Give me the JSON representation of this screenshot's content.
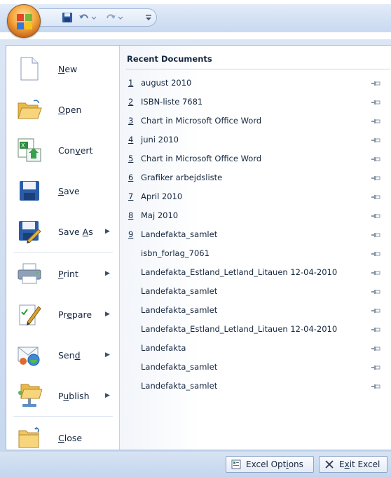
{
  "quick_access": {
    "save_icon": "save-icon",
    "undo_icon": "undo-icon",
    "redo_icon": "redo-icon",
    "customize_icon": "customize-icon"
  },
  "commands": [
    {
      "label": "New",
      "access_key_index": 0,
      "icon": "new-document-icon",
      "has_submenu": false
    },
    {
      "label": "Open",
      "access_key_index": 0,
      "icon": "open-folder-icon",
      "has_submenu": false
    },
    {
      "label": "Convert",
      "access_key_index": 3,
      "icon": "convert-icon",
      "has_submenu": false
    },
    {
      "label": "Save",
      "access_key_index": 0,
      "icon": "save-icon",
      "has_submenu": false
    },
    {
      "label": "Save As",
      "access_key_index": 5,
      "icon": "save-as-icon",
      "has_submenu": true
    },
    {
      "label": "Print",
      "access_key_index": 0,
      "icon": "printer-icon",
      "has_submenu": true
    },
    {
      "label": "Prepare",
      "access_key_index": 2,
      "icon": "prepare-icon",
      "has_submenu": true
    },
    {
      "label": "Send",
      "access_key_index": 3,
      "icon": "send-icon",
      "has_submenu": true
    },
    {
      "label": "Publish",
      "access_key_index": 1,
      "icon": "publish-icon",
      "has_submenu": true
    },
    {
      "label": "Close",
      "access_key_index": 0,
      "icon": "close-folder-icon",
      "has_submenu": false
    }
  ],
  "recent": {
    "header": "Recent Documents",
    "documents": [
      {
        "num": "1",
        "name": "august 2010"
      },
      {
        "num": "2",
        "name": "ISBN-liste 7681"
      },
      {
        "num": "3",
        "name": "Chart in Microsoft Office Word"
      },
      {
        "num": "4",
        "name": "juni 2010"
      },
      {
        "num": "5",
        "name": "Chart in Microsoft Office Word"
      },
      {
        "num": "6",
        "name": "Grafiker arbejdsliste"
      },
      {
        "num": "7",
        "name": "April 2010"
      },
      {
        "num": "8",
        "name": "Maj 2010"
      },
      {
        "num": "9",
        "name": "Landefakta_samlet"
      },
      {
        "num": "",
        "name": "isbn_forlag_7061"
      },
      {
        "num": "",
        "name": "Landefakta_Estland_Letland_Litauen 12-04-2010"
      },
      {
        "num": "",
        "name": "Landefakta_samlet"
      },
      {
        "num": "",
        "name": "Landefakta_samlet"
      },
      {
        "num": "",
        "name": "Landefakta_Estland_Letland_Litauen 12-04-2010"
      },
      {
        "num": "",
        "name": "Landefakta"
      },
      {
        "num": "",
        "name": "Landefakta_samlet"
      },
      {
        "num": "",
        "name": "Landefakta_samlet"
      }
    ]
  },
  "footer": {
    "options_label": "Excel Options",
    "options_access_index": 9,
    "exit_label": "Exit Excel",
    "exit_access_index": 1
  },
  "colors": {
    "accent": "#c8641a",
    "menu_frame": "#c6d7ee",
    "text": "#15273f"
  }
}
